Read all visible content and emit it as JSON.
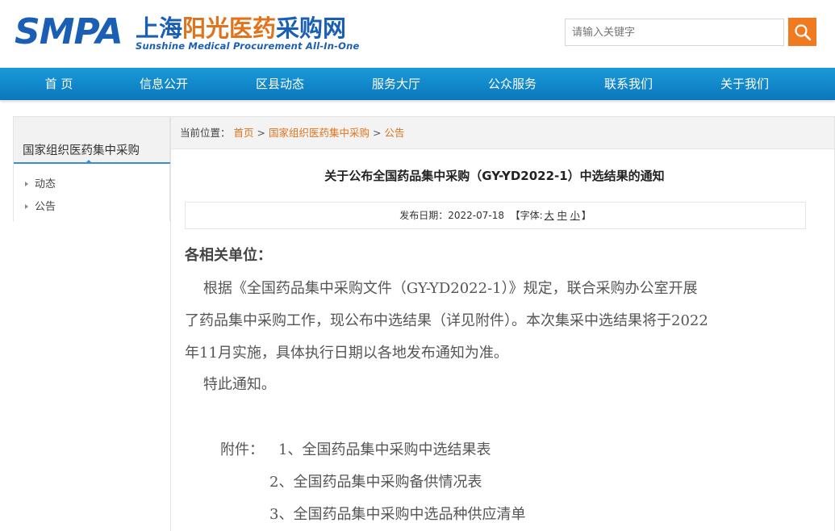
{
  "header": {
    "logo_smpa": "SMPA",
    "logo_cn_1": "上海",
    "logo_cn_2": "阳光",
    "logo_cn_3": "医药",
    "logo_cn_4": "采购网",
    "logo_en": "Sunshine Medical Procurement All-In-One",
    "search_placeholder": "请输入关键字"
  },
  "nav": {
    "items": [
      {
        "label": "首 页"
      },
      {
        "label": "信息公开"
      },
      {
        "label": "区县动态"
      },
      {
        "label": "服务大厅"
      },
      {
        "label": "公众服务"
      },
      {
        "label": "联系我们"
      },
      {
        "label": "关于我们"
      }
    ]
  },
  "sidebar": {
    "title": "国家组织医药集中采购",
    "items": [
      {
        "label": "动态"
      },
      {
        "label": "公告"
      }
    ]
  },
  "breadcrumb": {
    "prefix": "当前位置：",
    "items": [
      "首页",
      "国家组织医药集中采购",
      "公告"
    ],
    "separator": ">"
  },
  "article": {
    "title": "关于公布全国药品集中采购（GY-YD2022-1）中选结果的通知",
    "date_label": "发布日期：",
    "date": "2022-07-18",
    "font_label_open": "【字体:",
    "font_large": "大",
    "font_medium": "中",
    "font_small": "小",
    "font_label_close": "】",
    "salutation": "各相关单位：",
    "paragraph_lines": [
      "    根据《全国药品集中采购文件（GY-YD2022-1）》规定，联合采购办公室开展",
      "了药品集中采购工作，现公布中选结果（详见附件）。本次集采中选结果将于2022",
      "年11月实施，具体执行日期以各地发布通知为准。",
      "    特此通知。"
    ],
    "attachments_label": "附件：",
    "attachments": [
      "1、全国药品集中采购中选结果表",
      "2、全国药品集中采购备供情况表",
      "3、全国药品集中采购中选品种供应清单"
    ]
  },
  "colors": {
    "brand_blue": "#1a5fb4",
    "brand_orange": "#e0731c",
    "nav_blue": "#0a78bd",
    "search_button": "#f07a20"
  }
}
